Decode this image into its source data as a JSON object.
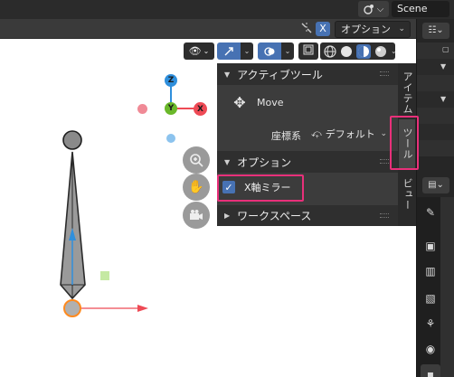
{
  "topbar": {
    "scene_icon": "scene-icon",
    "scene_name": "Scene"
  },
  "viewport_header": {
    "mirror_icon": "mirror-axis-icon",
    "x_mirror_label": "X",
    "options_label": "オプション"
  },
  "viewport_toolbar": {
    "visibility_icon": "eye-icon",
    "gizmo_icon": "gizmo-icon",
    "overlay_icon": "overlay-icon",
    "xray_icon": "xray-icon",
    "shading_icons": [
      "wireframe-icon",
      "solid-icon",
      "material-preview-icon",
      "rendered-icon"
    ]
  },
  "gizmo": {
    "z_label": "Z",
    "y_label": "Y",
    "x_label": "X",
    "colors": {
      "x": "#ee4a55",
      "y": "#6ab82a",
      "z": "#2f8fdc"
    }
  },
  "nav_buttons": [
    "zoom-icon",
    "hand-icon",
    "camera-icon"
  ],
  "n_panel": {
    "active_tool": {
      "title": "アクティブツール",
      "tool_name": "Move",
      "coord_label": "座標系",
      "coord_value": "デフォルト"
    },
    "options": {
      "title": "オプション",
      "x_mirror_label": "X軸ミラー",
      "x_mirror_checked": true
    },
    "workspace": {
      "title": "ワークスペース"
    },
    "tabs": [
      "アイテム",
      "ツール",
      "ビュー"
    ],
    "active_tab": "ツール"
  },
  "colors": {
    "accent": "#4772b3",
    "highlight": "#e8307a"
  }
}
